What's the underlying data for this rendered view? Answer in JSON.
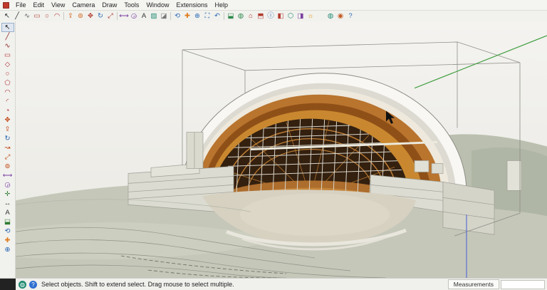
{
  "menu": {
    "items": [
      "File",
      "Edit",
      "View",
      "Camera",
      "Draw",
      "Tools",
      "Window",
      "Extensions",
      "Help"
    ]
  },
  "toolbar": {
    "icons": [
      {
        "name": "select",
        "glyph": "↖",
        "color": "#222222"
      },
      {
        "name": "line",
        "glyph": "╱",
        "color": "#333333"
      },
      {
        "name": "freehand",
        "glyph": "∿",
        "color": "#555555"
      },
      {
        "name": "rectangle",
        "glyph": "▭",
        "color": "#b23b2e"
      },
      {
        "name": "circle",
        "glyph": "○",
        "color": "#b23b2e"
      },
      {
        "name": "arc",
        "glyph": "◠",
        "color": "#b23b2e"
      },
      {
        "sep": true
      },
      {
        "name": "push-pull",
        "glyph": "⇪",
        "color": "#d2691e"
      },
      {
        "name": "offset",
        "glyph": "⊚",
        "color": "#d2691e"
      },
      {
        "name": "move",
        "glyph": "✥",
        "color": "#b23b2e"
      },
      {
        "name": "rotate",
        "glyph": "↻",
        "color": "#2e6db4"
      },
      {
        "name": "scale",
        "glyph": "⤢",
        "color": "#b23b2e"
      },
      {
        "sep": true
      },
      {
        "name": "tape-measure",
        "glyph": "⟷",
        "color": "#7a3fa0"
      },
      {
        "name": "protractor",
        "glyph": "◶",
        "color": "#7a3fa0"
      },
      {
        "name": "text",
        "glyph": "A",
        "color": "#333333"
      },
      {
        "name": "paint-bucket",
        "glyph": "▨",
        "color": "#1f8a70"
      },
      {
        "name": "eraser",
        "glyph": "◪",
        "color": "#777777"
      },
      {
        "sep": true
      },
      {
        "name": "orbit",
        "glyph": "⟲",
        "color": "#2e6db4"
      },
      {
        "name": "pan",
        "glyph": "✚",
        "color": "#e07b20"
      },
      {
        "name": "zoom",
        "glyph": "⊕",
        "color": "#2e6db4"
      },
      {
        "name": "zoom-extents",
        "glyph": "⛶",
        "color": "#2e6db4"
      },
      {
        "name": "previous-view",
        "glyph": "↶",
        "color": "#2e6db4"
      },
      {
        "sep": true
      },
      {
        "name": "section-plane",
        "glyph": "⬓",
        "color": "#2f8a4c"
      },
      {
        "name": "add-location",
        "glyph": "◍",
        "color": "#2f8a4c"
      },
      {
        "name": "3d-warehouse",
        "glyph": "⌂",
        "color": "#b23b2e"
      },
      {
        "name": "extension-warehouse",
        "glyph": "⬒",
        "color": "#b23b2e"
      },
      {
        "name": "model-info",
        "glyph": "ⓘ",
        "color": "#2e6db4"
      },
      {
        "name": "materials",
        "glyph": "◧",
        "color": "#b23b2e"
      },
      {
        "name": "components",
        "glyph": "⬡",
        "color": "#1f8a70"
      },
      {
        "name": "styles",
        "glyph": "◨",
        "color": "#7a3fa0"
      },
      {
        "name": "shadows",
        "glyph": "☼",
        "color": "#e0a020"
      },
      {
        "gap": true
      },
      {
        "name": "geolocation",
        "glyph": "◍",
        "color": "#1f8a70"
      },
      {
        "name": "user",
        "glyph": "◉",
        "color": "#c2571f"
      },
      {
        "name": "help",
        "glyph": "?",
        "color": "#2e6db4"
      }
    ]
  },
  "left_toolbar": {
    "icons": [
      {
        "name": "select-tool",
        "glyph": "↖",
        "color": "#111111",
        "active": true
      },
      {
        "name": "line-tool",
        "glyph": "╱",
        "color": "#8a1f1f"
      },
      {
        "name": "freehand-tool",
        "glyph": "∿",
        "color": "#8a1f1f"
      },
      {
        "name": "rectangle-tool",
        "glyph": "▭",
        "color": "#b03030"
      },
      {
        "name": "rotated-rectangle-tool",
        "glyph": "◇",
        "color": "#b03030"
      },
      {
        "name": "circle-tool",
        "glyph": "○",
        "color": "#b03030"
      },
      {
        "name": "polygon-tool",
        "glyph": "⬠",
        "color": "#b03030"
      },
      {
        "name": "arc-tool",
        "glyph": "◠",
        "color": "#b03030"
      },
      {
        "name": "two-point-arc-tool",
        "glyph": "◜",
        "color": "#b03030"
      },
      {
        "name": "pie-tool",
        "glyph": "◔",
        "color": "#b03030"
      },
      {
        "name": "move-tool",
        "glyph": "✥",
        "color": "#c24a18"
      },
      {
        "name": "push-pull-tool",
        "glyph": "⇪",
        "color": "#c24a18"
      },
      {
        "name": "rotate-tool",
        "glyph": "↻",
        "color": "#1f5fae"
      },
      {
        "name": "follow-me-tool",
        "glyph": "↝",
        "color": "#c24a18"
      },
      {
        "name": "scale-tool",
        "glyph": "⤢",
        "color": "#c24a18"
      },
      {
        "name": "offset-tool",
        "glyph": "⊚",
        "color": "#c24a18"
      },
      {
        "name": "tape-measure-tool",
        "glyph": "⟷",
        "color": "#7a3fa0"
      },
      {
        "name": "protractor-tool",
        "glyph": "◶",
        "color": "#7a3fa0"
      },
      {
        "name": "axes-tool",
        "glyph": "✛",
        "color": "#2e7d32"
      },
      {
        "name": "dimension-tool",
        "glyph": "↔",
        "color": "#333333"
      },
      {
        "name": "text-tool",
        "glyph": "A",
        "color": "#333333"
      },
      {
        "name": "section-plane-tool",
        "glyph": "⬓",
        "color": "#2e7d32"
      },
      {
        "name": "orbit-tool",
        "glyph": "⟲",
        "color": "#1f5fae"
      },
      {
        "name": "pan-tool",
        "glyph": "✚",
        "color": "#e07b20"
      },
      {
        "name": "zoom-tool",
        "glyph": "⊕",
        "color": "#1f5fae"
      }
    ]
  },
  "statusbar": {
    "hint": "Select objects. Shift to extend select. Drag mouse to select multiple.",
    "measurements_label": "Measurements",
    "measurements_value": "",
    "icons": [
      {
        "name": "geolocation-status",
        "glyph": "◍",
        "color": "#1f8a70"
      },
      {
        "name": "claim-credit",
        "glyph": "?",
        "color": "#2f6fd0"
      }
    ]
  },
  "colors": {
    "axis_green": "#44a044",
    "axis_blue": "#5b6fd0",
    "shell_wood": "#ad6d2c",
    "terrain": "#c5c7b9"
  }
}
